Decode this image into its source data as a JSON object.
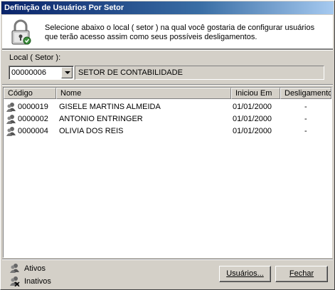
{
  "window": {
    "title": "Definição de Usuários Por Setor"
  },
  "header": {
    "description": "Selecione abaixo o local ( setor ) na qual você gostaria de configurar usuários\nque terão acesso assim como seus possíveis desligamentos.",
    "icon": "lock-icon"
  },
  "local": {
    "label": "Local ( Setor ):",
    "code": "00000006",
    "sector_name": "SETOR DE CONTABILIDADE"
  },
  "grid": {
    "columns": [
      "Código",
      "Nome",
      "Iniciou Em",
      "Desligamento"
    ],
    "rows": [
      {
        "codigo": "0000019",
        "nome": "GISELE MARTINS ALMEIDA",
        "inicio": "01/01/2000",
        "desligamento": "-",
        "status": "ativo"
      },
      {
        "codigo": "0000002",
        "nome": "ANTONIO ENTRINGER",
        "inicio": "01/01/2000",
        "desligamento": "-",
        "status": "ativo"
      },
      {
        "codigo": "0000004",
        "nome": "OLIVIA DOS REIS",
        "inicio": "01/01/2000",
        "desligamento": "-",
        "status": "ativo"
      }
    ]
  },
  "legend": {
    "ativos": "Ativos",
    "inativos": "Inativos"
  },
  "buttons": {
    "usuarios": "Usuários...",
    "fechar": "Fechar"
  }
}
